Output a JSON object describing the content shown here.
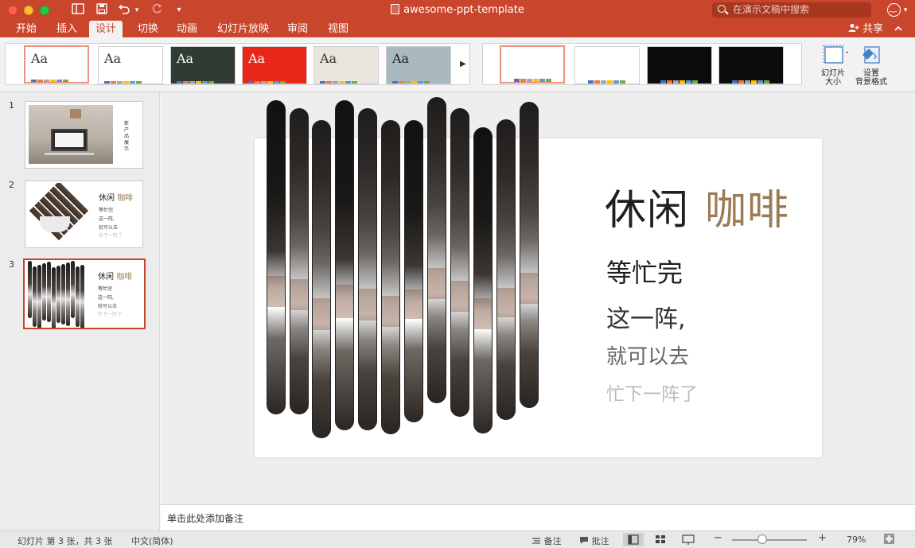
{
  "window": {
    "title": "awesome-ppt-template",
    "search_placeholder": "在演示文稿中搜索"
  },
  "toolbar": {
    "undo_arrow": "▾",
    "more": "▾"
  },
  "tabs": [
    {
      "label": "开始"
    },
    {
      "label": "插入"
    },
    {
      "label": "设计"
    },
    {
      "label": "切换"
    },
    {
      "label": "动画"
    },
    {
      "label": "幻灯片放映"
    },
    {
      "label": "审阅"
    },
    {
      "label": "视图"
    }
  ],
  "active_tab": "设计",
  "share_label": "共享",
  "themes": [
    {
      "label": "Aa",
      "bg": "#ffffff",
      "fg": "#333333",
      "selected": true
    },
    {
      "label": "Aa",
      "bg": "#ffffff",
      "fg": "#333333",
      "selected": false
    },
    {
      "label": "Aa",
      "bg": "#2f3b33",
      "fg": "#ffffff",
      "selected": false
    },
    {
      "label": "Aa",
      "bg": "#e8271a",
      "fg": "#ffffff",
      "selected": false
    },
    {
      "label": "Aa",
      "bg": "#e9e4dc",
      "fg": "#333333",
      "selected": false
    },
    {
      "label": "Aa",
      "bg": "#aab8bf",
      "fg": "#222222",
      "selected": false
    }
  ],
  "variants": [
    {
      "bg": "#ffffff",
      "selected": true
    },
    {
      "bg": "#ffffff",
      "selected": false
    },
    {
      "bg": "#0b0b0b",
      "selected": false
    },
    {
      "bg": "#0b0b0b",
      "selected": false
    }
  ],
  "ribbon_buttons": {
    "slide_size": {
      "line1": "幻灯片",
      "line2": "大小"
    },
    "format_background": {
      "line1": "设置",
      "line2": "背景格式"
    }
  },
  "thumbnails": [
    {
      "number": "1",
      "caption": "新产品展示"
    },
    {
      "number": "2",
      "title": "休闲",
      "title_accent": "咖啡",
      "lines": [
        "等忙完",
        "这一阵,",
        "就可以去",
        "忙下一阵了"
      ]
    },
    {
      "number": "3",
      "title": "休闲",
      "title_accent": "咖啡",
      "lines": [
        "等忙完",
        "这一阵,",
        "就可以去",
        "忙下一阵了"
      ]
    }
  ],
  "slide": {
    "title": "休闲",
    "title_accent": "咖啡",
    "line1": "等忙完",
    "line2": "这一阵,",
    "line3": "就可以去",
    "line4": "忙下一阵了"
  },
  "notes_placeholder": "单击此处添加备注",
  "status": {
    "slide_info": "幻灯片 第 3 张，共 3 张",
    "language": "中文(简体)",
    "notes": "备注",
    "comments": "批注",
    "zoom_minus": "−",
    "zoom_plus": "+",
    "zoom": "79%"
  },
  "colors": {
    "accent": "#c9452b",
    "title_accent": "#9b7a55"
  }
}
